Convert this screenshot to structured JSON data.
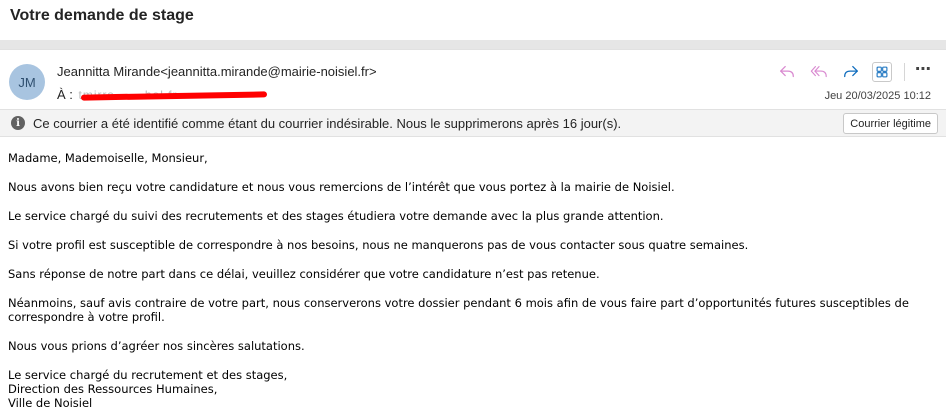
{
  "subject": "Votre demande de stage",
  "sender": {
    "initials": "JM",
    "display": "Jeannitta Mirande<jeannitta.mirande@mairie-noisiel.fr>"
  },
  "recipient": {
    "label": "À :",
    "value_redacted": "tmirrs.......hol.fr"
  },
  "date": "Jeu 20/03/2025 10:12",
  "toolbar": {
    "reply_icon": "reply-icon",
    "reply_all_icon": "reply-all-icon",
    "forward_icon": "forward-icon",
    "apps_icon": "apps-icon",
    "more_label": "⋯"
  },
  "junk_notice": {
    "icon": "info-icon",
    "text": "Ce courrier a été identifié comme étant du courrier indésirable. Nous le supprimerons après 16 jour(s).",
    "button_label": "Courrier légitime"
  },
  "body": {
    "greeting": "Madame, Mademoiselle, Monsieur,",
    "p1": "Nous avons bien reçu votre candidature et nous vous remercions de l’intérêt que vous portez à la mairie de Noisiel.",
    "p2": "Le service chargé du suivi des recrutements et des stages étudiera votre demande avec la plus grande attention.",
    "p3": "Si votre profil est susceptible de correspondre à nos besoins, nous ne manquerons pas de vous contacter sous quatre semaines.",
    "p4": "Sans réponse de notre part dans ce délai, veuillez considérer que votre candidature n’est pas retenue.",
    "p5": "Néanmoins, sauf avis contraire de votre part, nous conserverons votre dossier pendant 6 mois afin de vous faire part d’opportunités futures susceptibles de correspondre à votre profil.",
    "p6": "Nous vous prions d’agréer nos sincères salutations.",
    "sig1": "Le service chargé du recrutement et des stages,",
    "sig2": "Direction des Ressources Humaines,",
    "sig3": "Ville de Noisiel"
  },
  "colors": {
    "action_pink": "#c239b3",
    "action_blue": "#0f6cbd",
    "redaction": "#ff0000"
  }
}
